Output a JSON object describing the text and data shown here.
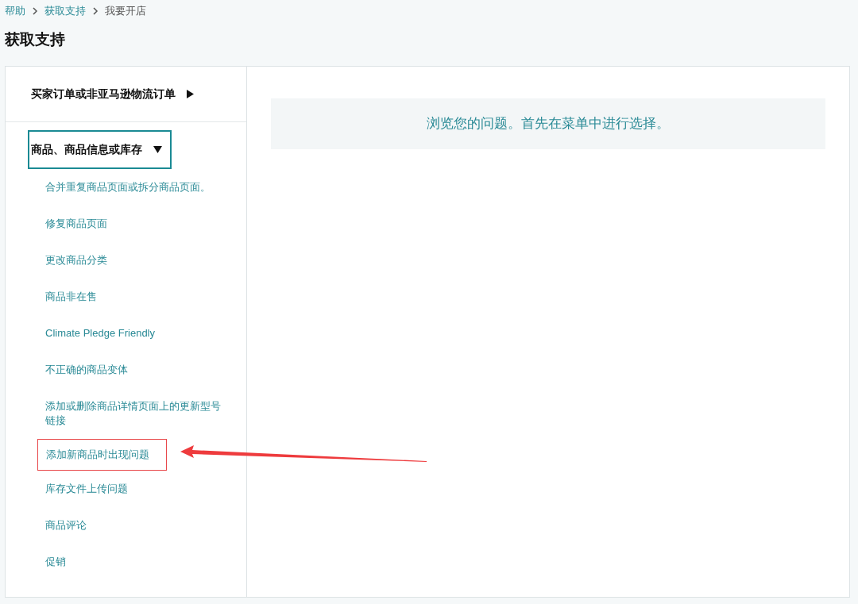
{
  "breadcrumb": [
    {
      "label": "帮助",
      "current": false
    },
    {
      "label": "获取支持",
      "current": false
    },
    {
      "label": "我要开店",
      "current": true
    }
  ],
  "page_title": "获取支持",
  "categories": [
    {
      "label": "买家订单或非亚马逊物流订单",
      "expanded": false,
      "focused": false
    },
    {
      "label": "商品、商品信息或库存",
      "expanded": true,
      "focused": true,
      "items": [
        {
          "label": "合并重复商品页面或拆分商品页面。",
          "annotated": false
        },
        {
          "label": "修复商品页面",
          "annotated": false
        },
        {
          "label": "更改商品分类",
          "annotated": false
        },
        {
          "label": "商品非在售",
          "annotated": false
        },
        {
          "label": "Climate Pledge Friendly",
          "annotated": false
        },
        {
          "label": "不正确的商品变体",
          "annotated": false
        },
        {
          "label": "添加或删除商品详情页面上的更新型号链接",
          "annotated": false
        },
        {
          "label": "添加新商品时出现问题",
          "annotated": true
        },
        {
          "label": "库存文件上传问题",
          "annotated": false
        },
        {
          "label": "商品评论",
          "annotated": false
        },
        {
          "label": "促销",
          "annotated": false
        }
      ]
    }
  ],
  "message": "浏览您的问题。首先在菜单中进行选择。"
}
